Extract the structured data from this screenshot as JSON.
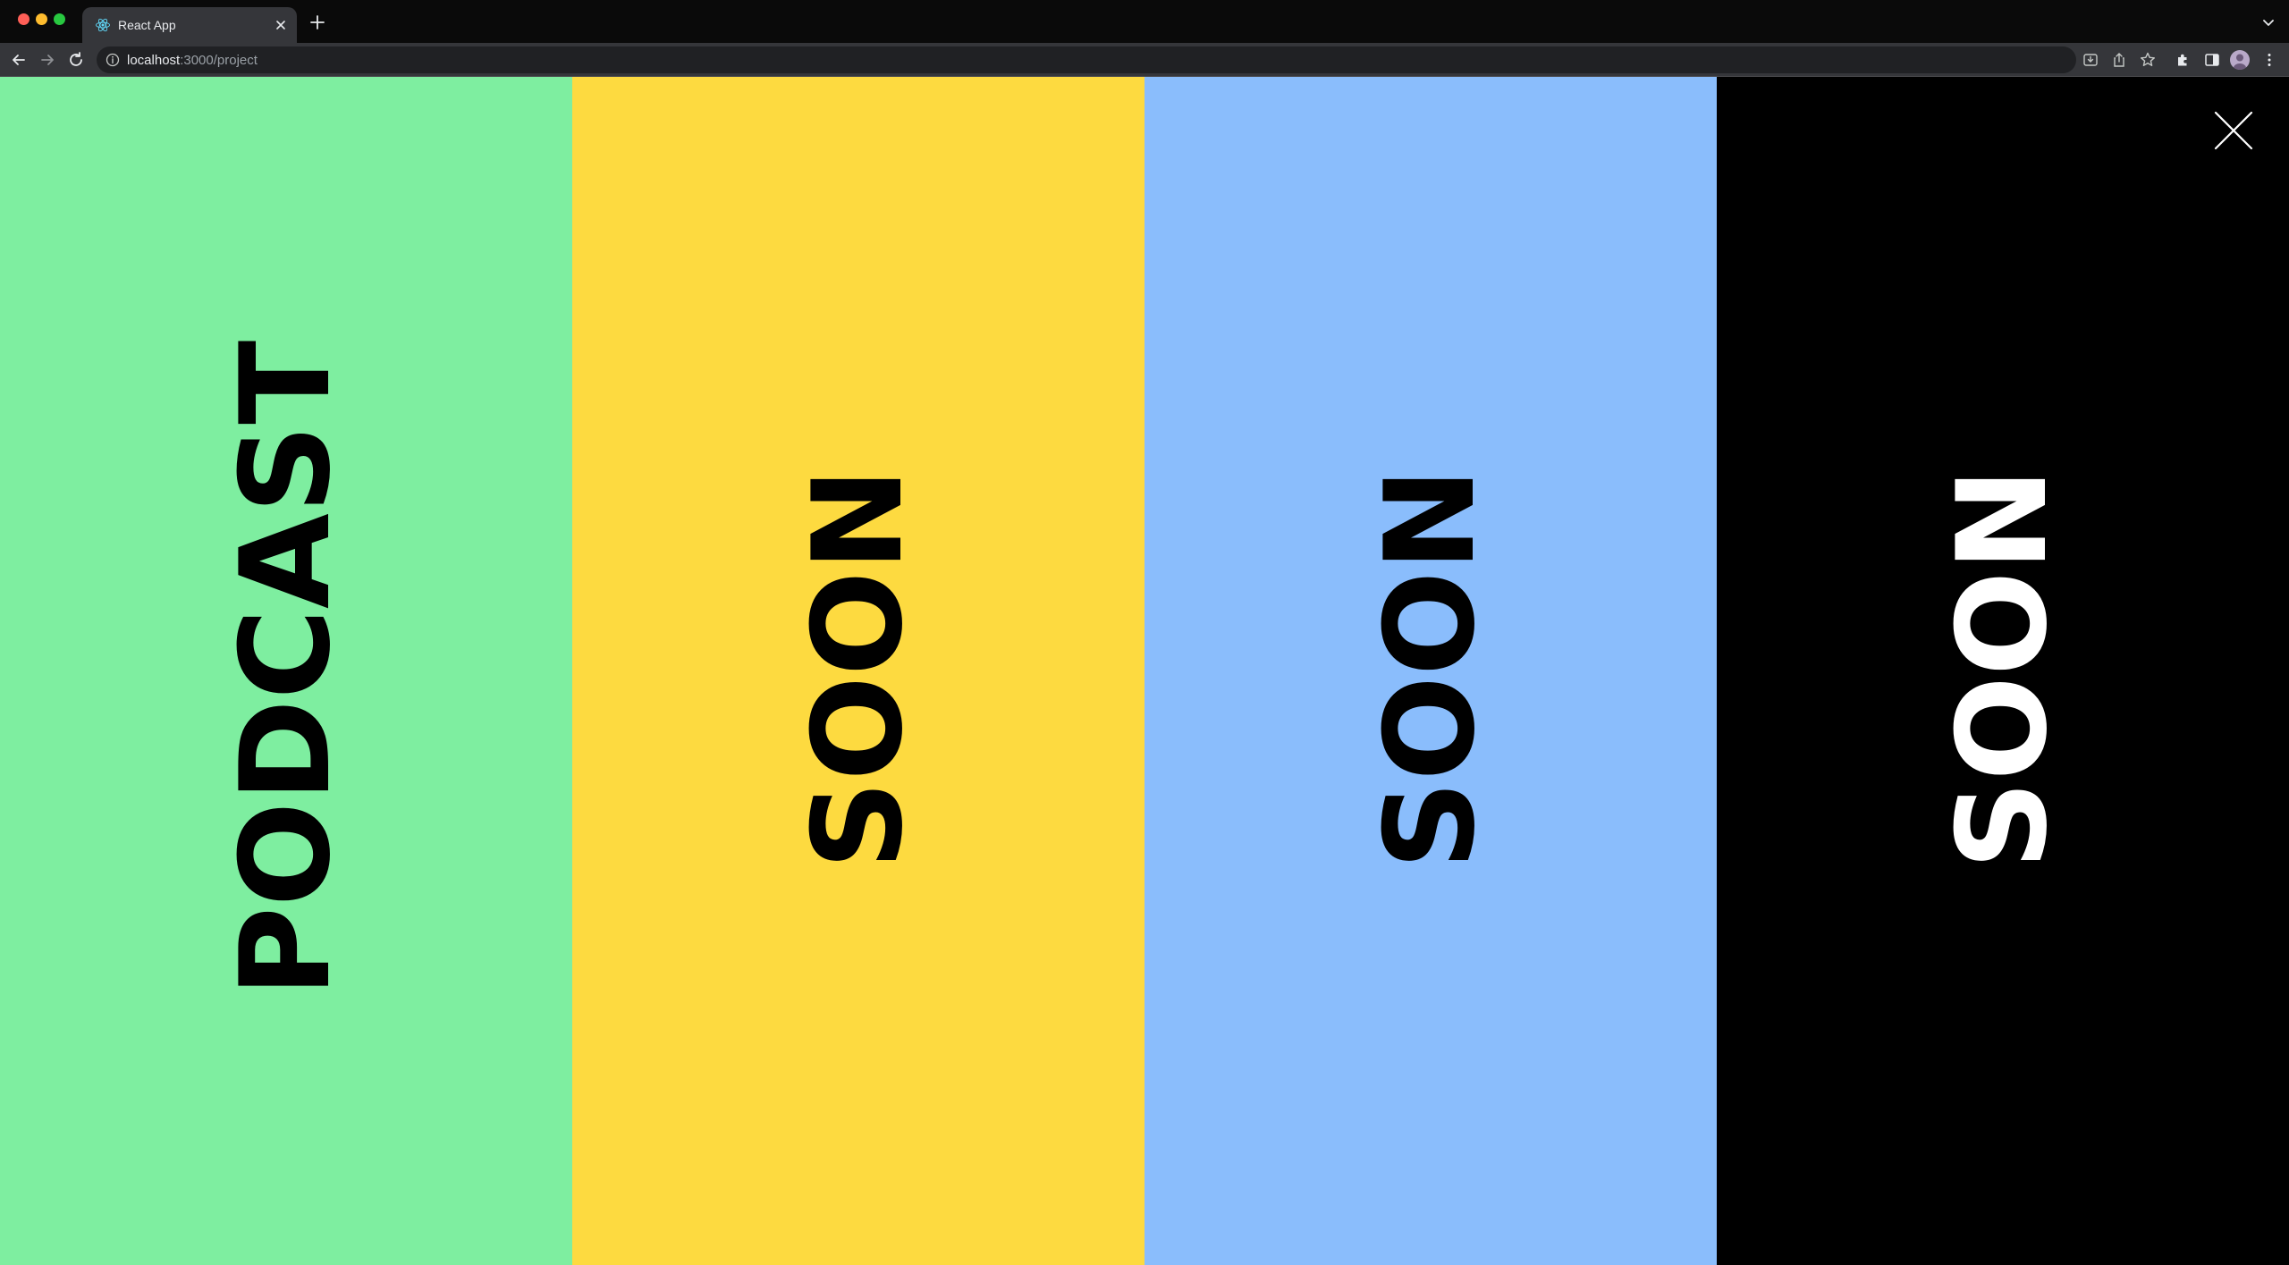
{
  "browser": {
    "tab_title": "React App",
    "url_host": "localhost",
    "url_path": ":3000/project",
    "colors": {
      "titlebar": "#0a0a0a",
      "tab": "#35363a",
      "toolbar": "#35363a",
      "omnibox": "#202124",
      "traffic_close": "#ff5f57",
      "traffic_minimize": "#febc2e",
      "traffic_zoom": "#28c840"
    },
    "icons": [
      "react-favicon-icon",
      "close-icon",
      "plus-icon",
      "chevron-down-icon",
      "back-arrow-icon",
      "forward-arrow-icon",
      "reload-icon",
      "info-icon",
      "install-icon",
      "share-icon",
      "star-icon",
      "extensions-icon",
      "side-panel-icon",
      "avatar",
      "kebab-menu-icon"
    ]
  },
  "page": {
    "panels": [
      {
        "label": "PODCAST",
        "background": "#7eeea0",
        "text_color": "#000000"
      },
      {
        "label": "SOON",
        "background": "#fdda40",
        "text_color": "#000000"
      },
      {
        "label": "SOON",
        "background": "#8abdfc",
        "text_color": "#000000"
      },
      {
        "label": "SOON",
        "background": "#000000",
        "text_color": "#ffffff"
      }
    ],
    "close_icon": "close-icon"
  }
}
